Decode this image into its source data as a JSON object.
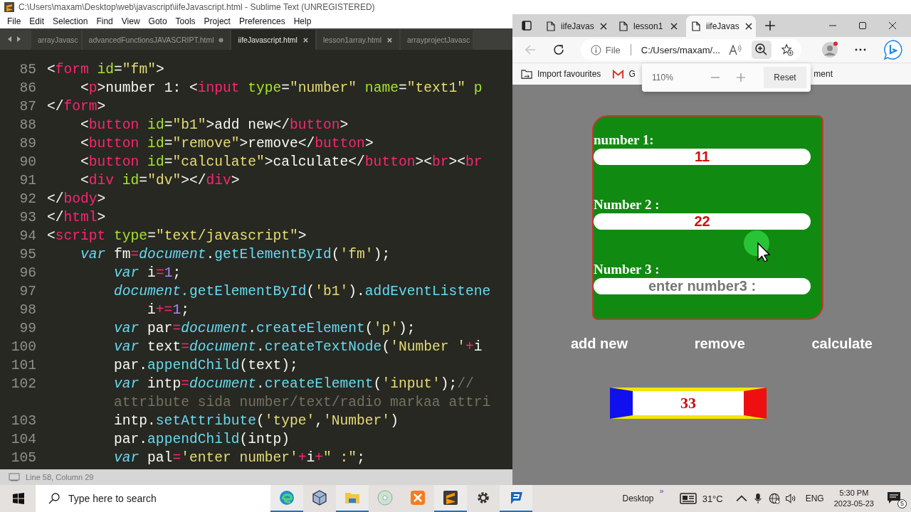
{
  "editor": {
    "title": "C:\\Users\\maxam\\Desktop\\web\\javascript\\iifeJavascript.html - Sublime Text (UNREGISTERED)",
    "menu": [
      "File",
      "Edit",
      "Selection",
      "Find",
      "View",
      "Goto",
      "Tools",
      "Project",
      "Preferences",
      "Help"
    ],
    "tabs": [
      {
        "label": "arrayJavasc",
        "selected": false,
        "modified": false,
        "closable": false
      },
      {
        "label": "advancedFunctionsJAVASCRIPT.html",
        "selected": false,
        "modified": true,
        "closable": true
      },
      {
        "label": "iifeJavascript.html",
        "selected": true,
        "modified": false,
        "closable": true
      },
      {
        "label": "lesson1array.html",
        "selected": false,
        "modified": false,
        "closable": true
      },
      {
        "label": "arrayprojectJavasc",
        "selected": false,
        "modified": false,
        "closable": false
      }
    ],
    "lines": [
      {
        "number": "85",
        "kind": "top",
        "tokens": [
          {
            "kind": "plain",
            "text": "<"
          },
          {
            "kind": "tag",
            "text": "form"
          },
          {
            "kind": "attr",
            "text": " id"
          },
          {
            "kind": "plain",
            "text": "="
          },
          {
            "kind": "string",
            "text": "\"fm\""
          },
          {
            "kind": "plain",
            "text": ">"
          }
        ]
      },
      {
        "number": "86",
        "kind": "inner",
        "tokens": [
          {
            "kind": "plain",
            "text": "<"
          },
          {
            "kind": "tag",
            "text": "p"
          },
          {
            "kind": "plain",
            "text": ">number 1: <"
          },
          {
            "kind": "tag",
            "text": "input"
          },
          {
            "kind": "attr",
            "text": " type"
          },
          {
            "kind": "plain",
            "text": "="
          },
          {
            "kind": "string",
            "text": "\"number\""
          },
          {
            "kind": "attr",
            "text": " name"
          },
          {
            "kind": "plain",
            "text": "="
          },
          {
            "kind": "string",
            "text": "\"text1\""
          },
          {
            "kind": "attr",
            "text": " p"
          }
        ]
      },
      {
        "number": "87",
        "kind": "top",
        "tokens": [
          {
            "kind": "plain",
            "text": "</"
          },
          {
            "kind": "tag",
            "text": "form"
          },
          {
            "kind": "plain",
            "text": ">"
          }
        ]
      },
      {
        "number": "88",
        "kind": "inner",
        "tokens": [
          {
            "kind": "plain",
            "text": "<"
          },
          {
            "kind": "tag",
            "text": "button"
          },
          {
            "kind": "attr",
            "text": " id"
          },
          {
            "kind": "plain",
            "text": "="
          },
          {
            "kind": "string",
            "text": "\"b1\""
          },
          {
            "kind": "plain",
            "text": ">add new</"
          },
          {
            "kind": "tag",
            "text": "button"
          },
          {
            "kind": "plain",
            "text": ">"
          }
        ]
      },
      {
        "number": "89",
        "kind": "inner",
        "tokens": [
          {
            "kind": "plain",
            "text": "<"
          },
          {
            "kind": "tag",
            "text": "button"
          },
          {
            "kind": "attr",
            "text": " id"
          },
          {
            "kind": "plain",
            "text": "="
          },
          {
            "kind": "string",
            "text": "\"remove\""
          },
          {
            "kind": "plain",
            "text": ">remove</"
          },
          {
            "kind": "tag",
            "text": "button"
          },
          {
            "kind": "plain",
            "text": ">"
          }
        ]
      },
      {
        "number": "90",
        "kind": "inner",
        "tokens": [
          {
            "kind": "plain",
            "text": "<"
          },
          {
            "kind": "tag",
            "text": "button"
          },
          {
            "kind": "attr",
            "text": " id"
          },
          {
            "kind": "plain",
            "text": "="
          },
          {
            "kind": "string",
            "text": "\"calculate\""
          },
          {
            "kind": "plain",
            "text": ">calculate</"
          },
          {
            "kind": "tag",
            "text": "button"
          },
          {
            "kind": "plain",
            "text": "><"
          },
          {
            "kind": "tag",
            "text": "br"
          },
          {
            "kind": "plain",
            "text": "><"
          },
          {
            "kind": "tag",
            "text": "br"
          }
        ]
      },
      {
        "number": "91",
        "kind": "inner",
        "tokens": [
          {
            "kind": "plain",
            "text": "<"
          },
          {
            "kind": "tag",
            "text": "div"
          },
          {
            "kind": "attr",
            "text": " id"
          },
          {
            "kind": "plain",
            "text": "="
          },
          {
            "kind": "string",
            "text": "\"dv\""
          },
          {
            "kind": "plain",
            "text": "></"
          },
          {
            "kind": "tag",
            "text": "div"
          },
          {
            "kind": "plain",
            "text": ">"
          }
        ]
      },
      {
        "number": "92",
        "kind": "top",
        "tokens": [
          {
            "kind": "plain",
            "text": "</"
          },
          {
            "kind": "tag",
            "text": "body"
          },
          {
            "kind": "plain",
            "text": ">"
          }
        ]
      },
      {
        "number": "93",
        "kind": "top",
        "tokens": [
          {
            "kind": "plain",
            "text": "</"
          },
          {
            "kind": "tag",
            "text": "html"
          },
          {
            "kind": "plain",
            "text": ">"
          }
        ]
      },
      {
        "number": "94",
        "kind": "top",
        "tokens": [
          {
            "kind": "plain",
            "text": "<"
          },
          {
            "kind": "tag",
            "text": "script"
          },
          {
            "kind": "attr",
            "text": " type"
          },
          {
            "kind": "plain",
            "text": "="
          },
          {
            "kind": "string",
            "text": "\"text/javascript\""
          },
          {
            "kind": "plain",
            "text": ">"
          }
        ]
      },
      {
        "number": "95",
        "kind": "inner",
        "tokens": [
          {
            "kind": "keyword",
            "text": "var"
          },
          {
            "kind": "plain",
            "text": " fm"
          },
          {
            "kind": "operator",
            "text": "="
          },
          {
            "kind": "object",
            "text": "document"
          },
          {
            "kind": "plain",
            "text": "."
          },
          {
            "kind": "function",
            "text": "getElementById"
          },
          {
            "kind": "plain",
            "text": "("
          },
          {
            "kind": "string",
            "text": "'fm'"
          },
          {
            "kind": "plain",
            "text": ");"
          }
        ]
      },
      {
        "number": "96",
        "kind": "deep",
        "tokens": [
          {
            "kind": "keyword",
            "text": "var"
          },
          {
            "kind": "plain",
            "text": " i"
          },
          {
            "kind": "operator",
            "text": "="
          },
          {
            "kind": "number",
            "text": "1"
          },
          {
            "kind": "plain",
            "text": ";"
          }
        ]
      },
      {
        "number": "97",
        "kind": "deep",
        "tokens": [
          {
            "kind": "object",
            "text": "document."
          },
          {
            "kind": "function",
            "text": "getElementById"
          },
          {
            "kind": "plain",
            "text": "("
          },
          {
            "kind": "string",
            "text": "'b1'"
          },
          {
            "kind": "plain",
            "text": ")."
          },
          {
            "kind": "function",
            "text": "addEventListene"
          }
        ]
      },
      {
        "number": "98",
        "kind": "deeper",
        "tokens": [
          {
            "kind": "plain",
            "text": "i"
          },
          {
            "kind": "operator",
            "text": "+="
          },
          {
            "kind": "number",
            "text": "1"
          },
          {
            "kind": "plain",
            "text": ";"
          }
        ]
      },
      {
        "number": "99",
        "kind": "deep",
        "tokens": [
          {
            "kind": "keyword",
            "text": "var"
          },
          {
            "kind": "plain",
            "text": " par"
          },
          {
            "kind": "operator",
            "text": "="
          },
          {
            "kind": "object",
            "text": "document"
          },
          {
            "kind": "plain",
            "text": "."
          },
          {
            "kind": "function",
            "text": "createElement"
          },
          {
            "kind": "plain",
            "text": "("
          },
          {
            "kind": "string",
            "text": "'p'"
          },
          {
            "kind": "plain",
            "text": ");"
          }
        ]
      },
      {
        "number": "100",
        "kind": "deep",
        "tokens": [
          {
            "kind": "keyword",
            "text": "var"
          },
          {
            "kind": "plain",
            "text": " text"
          },
          {
            "kind": "operator",
            "text": "="
          },
          {
            "kind": "object",
            "text": "document"
          },
          {
            "kind": "plain",
            "text": "."
          },
          {
            "kind": "function",
            "text": "createTextNode"
          },
          {
            "kind": "plain",
            "text": "("
          },
          {
            "kind": "string",
            "text": "'Number '"
          },
          {
            "kind": "operator",
            "text": "+"
          },
          {
            "kind": "plain",
            "text": "i"
          }
        ]
      },
      {
        "number": "101",
        "kind": "deep",
        "tokens": [
          {
            "kind": "plain",
            "text": "par."
          },
          {
            "kind": "function",
            "text": "appendChild"
          },
          {
            "kind": "plain",
            "text": "(text);"
          }
        ]
      },
      {
        "number": "102",
        "kind": "deep",
        "tokens": [
          {
            "kind": "keyword",
            "text": "var"
          },
          {
            "kind": "plain",
            "text": " intp"
          },
          {
            "kind": "operator",
            "text": "="
          },
          {
            "kind": "object",
            "text": "document"
          },
          {
            "kind": "plain",
            "text": "."
          },
          {
            "kind": "function",
            "text": "createElement"
          },
          {
            "kind": "plain",
            "text": "("
          },
          {
            "kind": "string",
            "text": "'input'"
          },
          {
            "kind": "plain",
            "text": ");"
          },
          {
            "kind": "comment",
            "text": "//"
          }
        ]
      },
      {
        "kind": "deep",
        "tokens": [
          {
            "kind": "comment",
            "text": "attribute sida number/text/radio markaa attri"
          }
        ]
      },
      {
        "number": "103",
        "kind": "deep",
        "tokens": [
          {
            "kind": "plain",
            "text": "intp."
          },
          {
            "kind": "function",
            "text": "setAttribute"
          },
          {
            "kind": "plain",
            "text": "("
          },
          {
            "kind": "string",
            "text": "'type'"
          },
          {
            "kind": "plain",
            "text": ","
          },
          {
            "kind": "string",
            "text": "'Number'"
          },
          {
            "kind": "plain",
            "text": ")"
          }
        ]
      },
      {
        "number": "104",
        "kind": "deep",
        "tokens": [
          {
            "kind": "plain",
            "text": "par."
          },
          {
            "kind": "function",
            "text": "appendChild"
          },
          {
            "kind": "plain",
            "text": "(intp)"
          }
        ]
      },
      {
        "number": "105",
        "kind": "deep",
        "tokens": [
          {
            "kind": "keyword",
            "text": "var"
          },
          {
            "kind": "plain",
            "text": " pal"
          },
          {
            "kind": "operator",
            "text": "="
          },
          {
            "kind": "string",
            "text": "'enter number'"
          },
          {
            "kind": "operator",
            "text": "+"
          },
          {
            "kind": "plain",
            "text": "i"
          },
          {
            "kind": "operator",
            "text": "+"
          },
          {
            "kind": "string",
            "text": "\" :\""
          },
          {
            "kind": "plain",
            "text": ";"
          }
        ]
      }
    ],
    "status": "Line 58, Column 29"
  },
  "browser": {
    "tabs": [
      {
        "label": "iifeJavas",
        "selected": false
      },
      {
        "label": "lesson1",
        "selected": false
      },
      {
        "label": "iifeJavas",
        "selected": true
      }
    ],
    "back": {
      "disabled": true
    },
    "address": {
      "scheme": "File",
      "url": "C:/Users/maxam/..."
    },
    "bookmarks": [
      {
        "kind": "import",
        "label": "Import favourites"
      },
      {
        "kind": "gmail",
        "label": "G"
      },
      {
        "kind": "plain",
        "label": "ment"
      }
    ],
    "zoom_popup": {
      "zoom": "110%",
      "reset": "Reset"
    },
    "page": {
      "fields": [
        {
          "label": "number 1:",
          "value": "11"
        },
        {
          "label": "Number 2 :",
          "value": "22"
        },
        {
          "label": "Number 3 :",
          "placeholder": "enter number3 :"
        }
      ],
      "buttons": [
        "add new",
        "remove",
        "calculate"
      ],
      "result": "33"
    }
  },
  "taskbar": {
    "search": {
      "placeholder": "Type here to search"
    },
    "apps": [
      {
        "kind": "edge",
        "open": true
      },
      {
        "kind": "box",
        "open": false
      },
      {
        "kind": "folder",
        "open": true
      },
      {
        "kind": "disc",
        "open": false
      },
      {
        "kind": "xampp",
        "open": false
      },
      {
        "kind": "sublime",
        "open": true
      },
      {
        "kind": "settings",
        "open": false
      },
      {
        "kind": "remote",
        "open": true
      }
    ],
    "desktop": "Desktop",
    "overflow": "»",
    "weather": "31°C",
    "language": "ENG",
    "time": "5:30 PM",
    "date": "2023-05-23",
    "notifications": "5"
  }
}
